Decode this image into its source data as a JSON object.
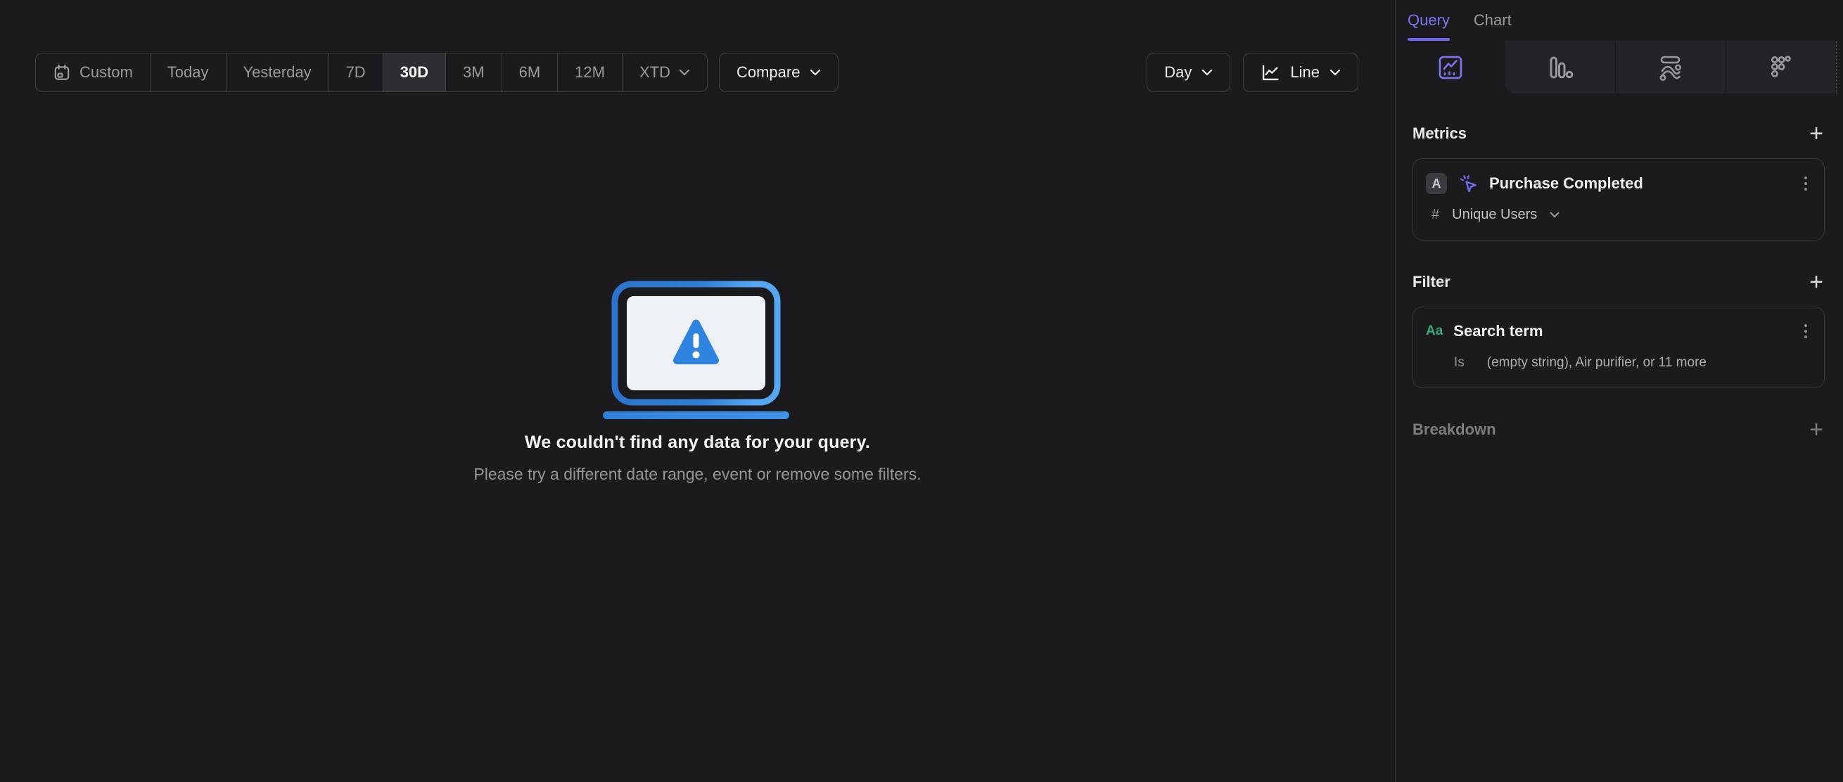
{
  "toolbar": {
    "date_ranges": [
      {
        "label": "Custom",
        "icon": "calendar-icon",
        "selected": false
      },
      {
        "label": "Today",
        "selected": false
      },
      {
        "label": "Yesterday",
        "selected": false
      },
      {
        "label": "7D",
        "selected": false
      },
      {
        "label": "30D",
        "selected": true
      },
      {
        "label": "3M",
        "selected": false
      },
      {
        "label": "6M",
        "selected": false
      },
      {
        "label": "12M",
        "selected": false
      },
      {
        "label": "XTD",
        "selected": false,
        "has_dropdown": true
      }
    ],
    "compare": {
      "label": "Compare",
      "has_dropdown": true
    },
    "granularity": {
      "label": "Day",
      "has_dropdown": true
    },
    "chart_type": {
      "label": "Line",
      "icon": "line-chart-icon",
      "has_dropdown": true
    }
  },
  "empty_state": {
    "illustration": "laptop-warning",
    "title": "We couldn't find any data for your query.",
    "subtitle": "Please try a different date range, event or remove some filters."
  },
  "panel": {
    "tabs": [
      {
        "label": "Query",
        "active": true
      },
      {
        "label": "Chart",
        "active": false
      }
    ],
    "chart_type_tabs": [
      {
        "icon": "insights-line-icon",
        "active": true
      },
      {
        "icon": "bar-chart-icon",
        "active": false
      },
      {
        "icon": "flow-chart-icon",
        "active": false
      },
      {
        "icon": "scatter-dots-icon",
        "active": false
      }
    ],
    "metrics": {
      "title": "Metrics",
      "add_label": "+",
      "items": [
        {
          "badge": "A",
          "icon": "event-click-icon",
          "name": "Purchase Completed",
          "agg_symbol": "#",
          "aggregation": "Unique Users"
        }
      ]
    },
    "filter": {
      "title": "Filter",
      "add_label": "+",
      "items": [
        {
          "type_label": "Aa",
          "name": "Search term",
          "operator": "Is",
          "values": "(empty string), Air purifier, or 11 more"
        }
      ]
    },
    "breakdown": {
      "title": "Breakdown",
      "add_label": "+"
    }
  },
  "colors": {
    "background": "#1b1b1e",
    "accent_purple": "#7d75f2",
    "tab_underline": "#6d65ea",
    "string_type_green": "#3ba87a",
    "illustration_blue": "#2f80da",
    "illustration_blue_light": "#55a7f2",
    "border": "#3f3f44",
    "text_primary": "#f5f5f6",
    "text_secondary": "#9a9b9f"
  }
}
